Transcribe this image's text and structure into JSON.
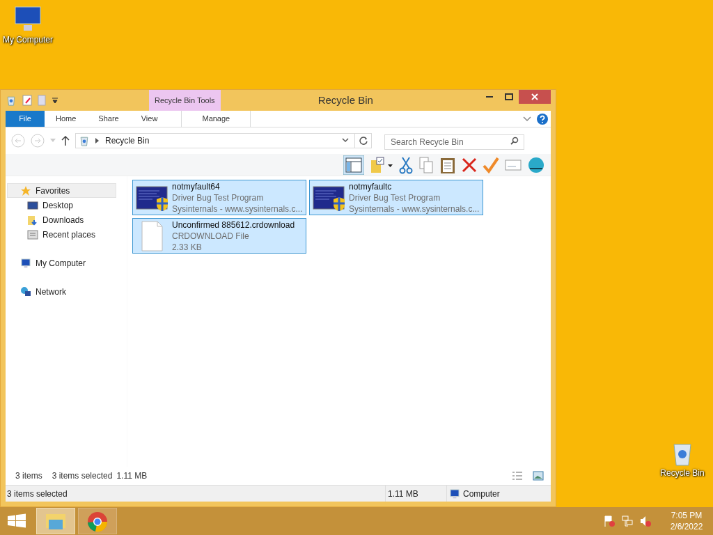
{
  "desktop_icons": [
    {
      "label": "My Computer",
      "kind": "computer"
    },
    {
      "label": "Recycle Bin",
      "kind": "recycle"
    }
  ],
  "window": {
    "title": "Recycle Bin",
    "context_group": "Recycle Bin Tools"
  },
  "ribbon_tabs": [
    {
      "label": "File",
      "kind": "file"
    },
    {
      "label": "Home",
      "kind": "normal"
    },
    {
      "label": "Share",
      "kind": "normal"
    },
    {
      "label": "View",
      "kind": "normal"
    },
    {
      "label": "Manage",
      "kind": "context"
    }
  ],
  "address": {
    "path": "Recycle Bin"
  },
  "search": {
    "placeholder": "Search Recycle Bin"
  },
  "sidebar": [
    {
      "label": "Favorites",
      "kind": "star",
      "selected": true,
      "children": [
        {
          "label": "Desktop",
          "kind": "desktop",
          "selected": false
        },
        {
          "label": "Downloads",
          "kind": "downloads",
          "selected": false
        },
        {
          "label": "Recent places",
          "kind": "recent",
          "selected": false
        }
      ]
    },
    {
      "label": "My Computer",
      "kind": "computer",
      "selected": false
    },
    {
      "label": "Network",
      "kind": "network",
      "selected": false
    }
  ],
  "files": [
    {
      "name": "notmyfault64",
      "line_2": "Driver Bug Test Program",
      "line_3": "Sysinternals - www.sysinternals.c...",
      "kind": "program",
      "selected": true
    },
    {
      "name": "notmyfaultc",
      "line_2": "Driver Bug Test Program",
      "line_3": "Sysinternals - www.sysinternals.c...",
      "kind": "program",
      "selected": true
    },
    {
      "name": "Unconfirmed 885612.crdownload",
      "line_2": "CRDOWNLOAD File",
      "line_3": "2.33 KB",
      "kind": "document",
      "selected": true
    }
  ],
  "view_status": {
    "count": "3 items",
    "selection": "3 items selected",
    "size": "1.11 MB"
  },
  "status_bar": {
    "text": "3 items selected",
    "size": "1.11 MB",
    "location": "Computer"
  },
  "taskbar": {
    "apps": [
      {
        "kind": "explorer",
        "selected": true
      },
      {
        "kind": "chrome",
        "selected": false
      }
    ],
    "time": "7:05 PM",
    "date": "2/6/2022"
  }
}
